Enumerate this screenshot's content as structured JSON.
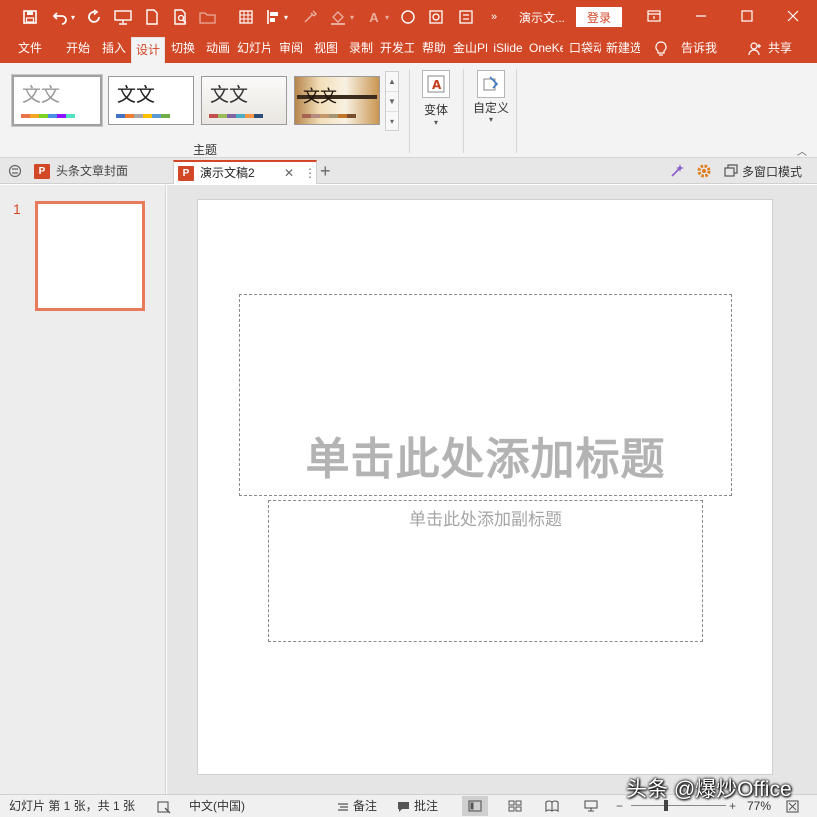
{
  "titlebar": {
    "doc_title": "演示文...",
    "login_label": "登录",
    "icons": [
      "save-icon",
      "undo-icon",
      "redo-icon",
      "slideshow-icon",
      "new-file-icon",
      "print-preview-icon",
      "open-icon",
      "grid-icon",
      "align-icon",
      "eyedropper-icon",
      "fill-icon",
      "font-color-icon",
      "shape-icon",
      "selection-icon",
      "more-icon"
    ],
    "window_controls": [
      "ribbon-display-icon",
      "minimize-icon",
      "maximize-icon",
      "close-icon"
    ]
  },
  "ribbon_tabs": [
    "文件",
    "开始",
    "插入",
    "设计",
    "切换",
    "动画",
    "幻灯片",
    "审阅",
    "视图",
    "录制",
    "开发工具",
    "帮助",
    "金山PDF",
    "iSlide",
    "OneKey",
    "口袋动画",
    "新建选项卡"
  ],
  "active_tab": "设计",
  "tell_me": "告诉我",
  "share": "共享",
  "ribbon": {
    "themes": [
      {
        "sample": "文文",
        "colors": [
          "#e8734a",
          "#f5a623",
          "#7ed321",
          "#4a90e2",
          "#9013fe",
          "#50e3c2"
        ]
      },
      {
        "sample": "文文",
        "colors": [
          "#4472c4",
          "#ed7d31",
          "#a5a5a5",
          "#ffc000",
          "#5b9bd5",
          "#70ad47"
        ]
      },
      {
        "sample": "文文",
        "colors": [
          "#c0504d",
          "#9bbb59",
          "#8064a2",
          "#4bacc6",
          "#f79646",
          "#2c4d75"
        ]
      },
      {
        "sample": "文文",
        "colors": [
          "#a5644e",
          "#b58b80",
          "#c3986d",
          "#a19574",
          "#c17529",
          "#7a4f2e"
        ]
      }
    ],
    "group_theme_label": "主题",
    "variant_label": "变体",
    "customize_label": "自定义",
    "gallery_scroll": [
      "▲",
      "▼",
      "▾"
    ]
  },
  "doc_tabs": [
    {
      "label": "头条文章封面",
      "active": false
    },
    {
      "label": "演示文稿2",
      "active": true
    }
  ],
  "new_tab": "+",
  "multiwindow_label": "多窗口模式",
  "slides": {
    "number": "1",
    "title_placeholder": "单击此处添加标题",
    "subtitle_placeholder": "单击此处添加副标题"
  },
  "statusbar": {
    "slide_info": "幻灯片 第 1 张，共 1 张",
    "language": "中文(中国)",
    "notes": "备注",
    "comments": "批注",
    "zoom": "77%",
    "zoom_level": 0.77
  },
  "watermark": "头条 @爆炒Office",
  "colors": {
    "accent": "#d24726",
    "ribbon_bg": "#f3f3f3",
    "workspace_bg": "#e5e5e5"
  }
}
